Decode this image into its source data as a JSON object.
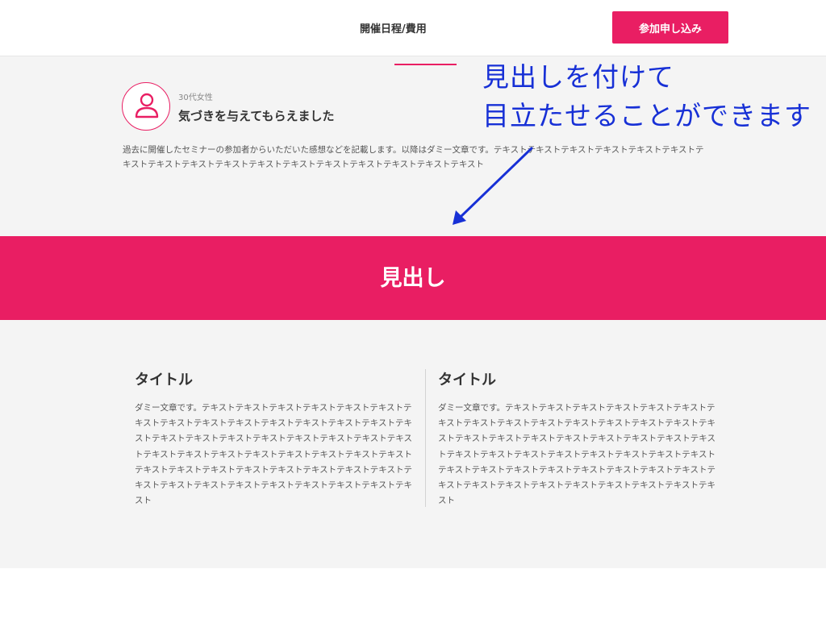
{
  "colors": {
    "accent": "#e91e63",
    "annotation": "#1730d6",
    "section_bg": "#f4f4f4"
  },
  "header": {
    "nav_label": "開催日程/費用",
    "cta_label": "参加申し込み"
  },
  "testimonial": {
    "avatar_icon": "user-icon",
    "reviewer": "30代女性",
    "title": "気づきを与えてもらえました",
    "body": "過去に開催したセミナーの参加者からいただいた感想などを記載します。以降はダミー文章です。テキストテキストテキストテキストテキストテキストテキストテキストテキストテキストテキストテキストテキストテキストテキストテキストテキスト"
  },
  "annotation": {
    "line1": "見出しを付けて",
    "line2": "目立たせることができます"
  },
  "heading_band": {
    "title": "見出し"
  },
  "columns": [
    {
      "title": "タイトル",
      "body": "ダミー文章です。テキストテキストテキストテキストテキストテキストテキストテキストテキストテキストテキストテキストテキストテキストテキストテキストテキストテキストテキストテキストテキストテキストテキストテキストテキストテキストテキストテキストテキストテキストテキストテキストテキストテキストテキストテキストテキストテキストテキストテキストテキストテキストテキストテキストテキストテキストテキストテキスト"
    },
    {
      "title": "タイトル",
      "body": "ダミー文章です。テキストテキストテキストテキストテキストテキストテキストテキストテキストテキストテキストテキストテキストテキストテキストテキストテキストテキストテキストテキストテキストテキストテキストテキストテキストテキストテキストテキストテキストテキストテキストテキストテキストテキストテキストテキストテキストテキストテキストテキストテキストテキストテキストテキストテキストテキストテキストテキスト"
    }
  ]
}
